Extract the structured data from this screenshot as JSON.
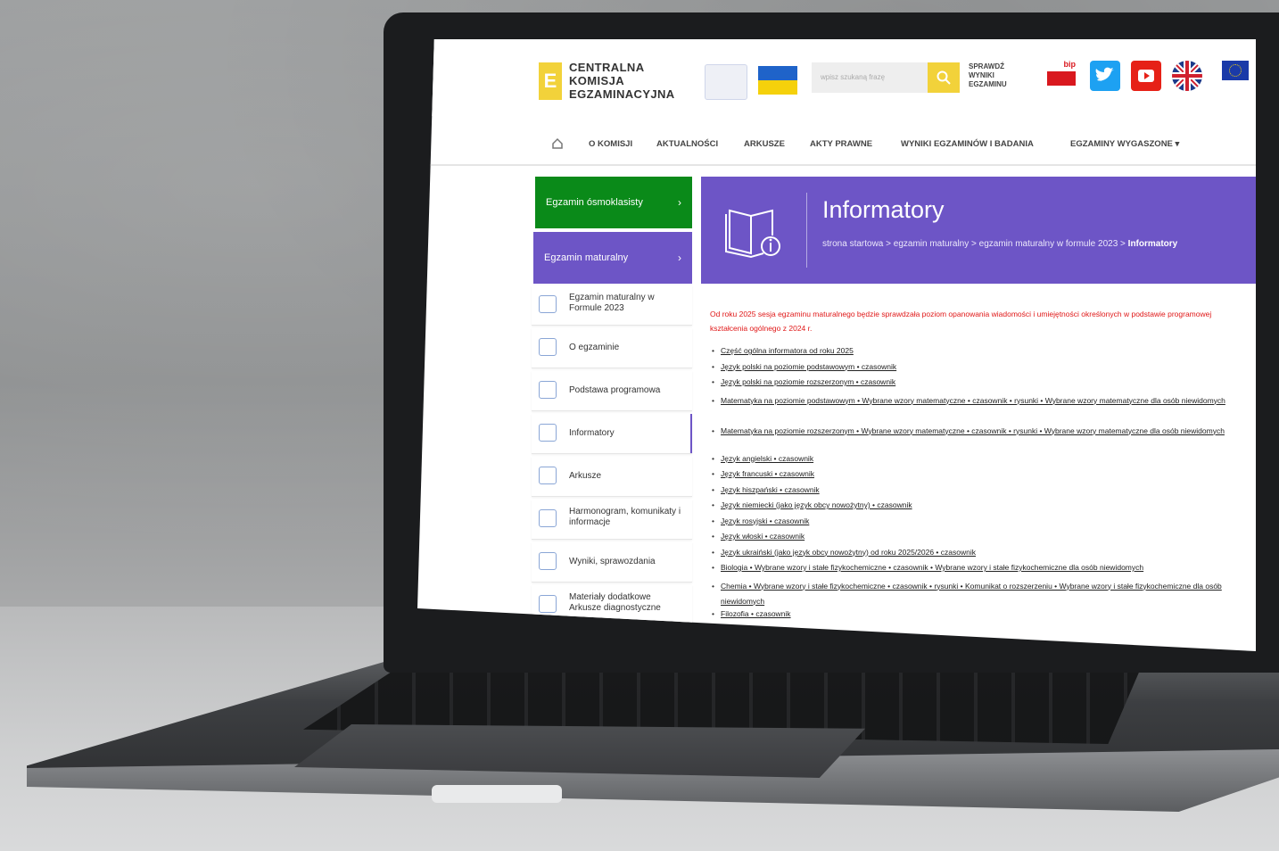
{
  "header": {
    "logo_mark": "E",
    "logo_lines": [
      "CENTRALNA",
      "KOMISJA",
      "EGZAMINACYJNA"
    ],
    "search_placeholder": "wpisz szukaną frazę",
    "check_results": [
      "SPRAWDŹ",
      "WYNIKI",
      "EGZAMINU"
    ],
    "bip_label": "bip"
  },
  "nav": {
    "items": [
      "O KOMISJI",
      "AKTUALNOŚCI",
      "ARKUSZE",
      "AKTY PRAWNE",
      "WYNIKI EGZAMINÓW I BADANIA",
      "EGZAMINY WYGASZONE ▾"
    ]
  },
  "sidebar": {
    "exam8": "Egzamin ósmoklasisty",
    "matura": "Egzamin maturalny",
    "items": [
      "Egzamin maturalny w Formule 2023",
      "O egzaminie",
      "Podstawa programowa",
      "Informatory",
      "Arkusze",
      "Harmonogram, komunikaty i informacje",
      "Wyniki, sprawozdania",
      "Materiały dodatkowe Arkusze diagnostyczne"
    ]
  },
  "banner": {
    "title": "Informatory",
    "crumb": "strona startowa > egzamin maturalny > egzamin maturalny w formule 2023 > ",
    "crumb_current": "Informatory"
  },
  "content": {
    "note": "Od roku 2025 sesja egzaminu maturalnego będzie sprawdzała poziom opanowania wiadomości i umiejętności określonych w podstawie programowej kształcenia ogólnego z 2024 r.",
    "items": [
      "Część ogólna informatora od roku 2025",
      "Język polski na poziomie podstawowym • czasownik",
      "Język polski na poziomie rozszerzonym • czasownik",
      "Matematyka na poziomie podstawowym • Wybrane wzory matematyczne • czasownik • rysunki • Wybrane wzory matematyczne dla osób niewidomych",
      "Matematyka na poziomie rozszerzonym • Wybrane wzory matematyczne • czasownik • rysunki • Wybrane wzory matematyczne dla osób niewidomych",
      "Język angielski • czasownik",
      "Język francuski • czasownik",
      "Język hiszpański • czasownik",
      "Język niemiecki (jako język obcy nowożytny) • czasownik",
      "Język rosyjski • czasownik",
      "Język włoski • czasownik",
      "Język ukraiński (jako język obcy nowożytny) od roku 2025/2026 • czasownik",
      "Biologia • Wybrane wzory i stałe fizykochemiczne • czasownik • Wybrane wzory i stałe fizykochemiczne dla osób niewidomych",
      "Chemia • Wybrane wzory i stałe fizykochemiczne • czasownik • rysunki • Komunikat o rozszerzeniu • Wybrane wzory i stałe fizykochemiczne dla osób niewidomych",
      "Filozofia • czasownik"
    ]
  },
  "colors": {
    "purple": "#6d55c6",
    "green": "#0a8a19",
    "yellow": "#f2d23a",
    "alert_red": "#e01818"
  }
}
